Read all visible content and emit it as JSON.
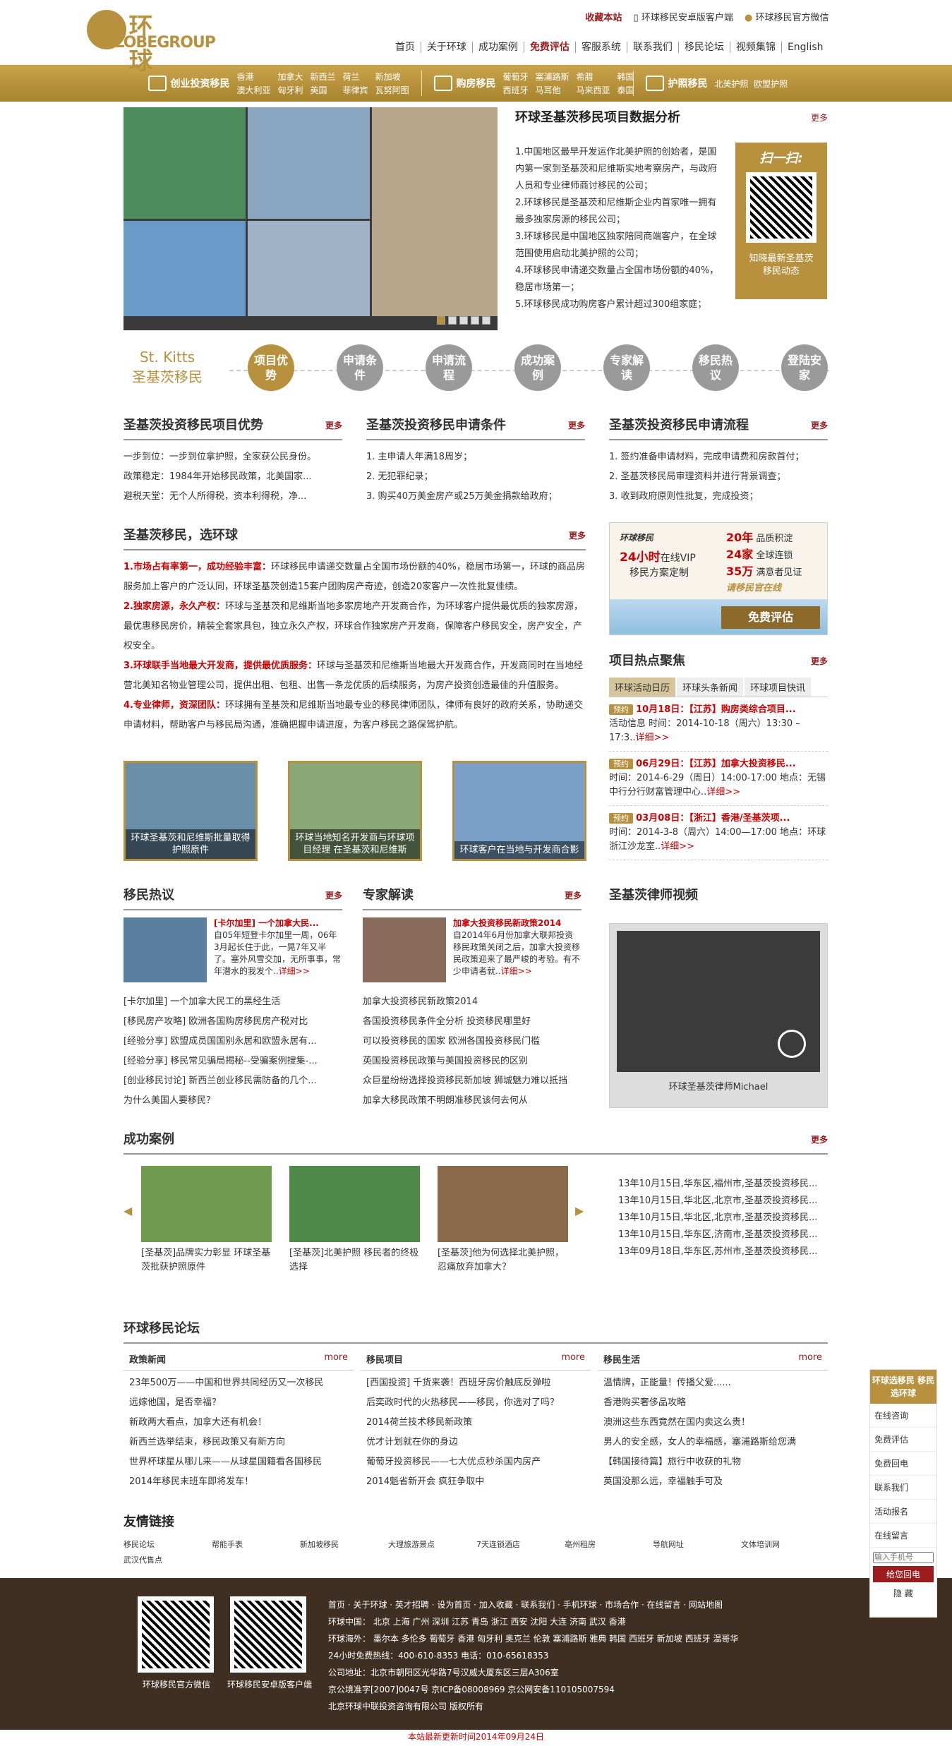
{
  "header": {
    "logo_cn": "环  球",
    "logo_en": "LOBEGROUP",
    "favorite": "收藏本站",
    "app_link": "环球移民安卓版客户端",
    "wechat_link": "环球移民官方微信",
    "nav": [
      "首页",
      "关于环球",
      "成功案例",
      "免费评估",
      "客服系统",
      "联系我们",
      "移民论坛",
      "视频集锦",
      "English"
    ]
  },
  "subbar": {
    "invest": {
      "title": "创业投资移民",
      "links": [
        "香港",
        "澳大利亚",
        "加拿大",
        "匈牙利",
        "新西兰",
        "英国",
        "荷兰",
        "菲律宾",
        "新加坡",
        "瓦努阿图"
      ]
    },
    "house": {
      "title": "购房移民",
      "links": [
        "葡萄牙",
        "塞浦路斯",
        "希腊",
        "韩国",
        "西班牙",
        "马耳他",
        "马来西亚",
        "泰国"
      ]
    },
    "passport": {
      "title": "护照移民",
      "links": [
        "北美护照",
        "欧盟护照"
      ]
    }
  },
  "data_section": {
    "title": "环球圣基茨移民项目数据分析",
    "more": "更多",
    "items": [
      "1.中国地区最早开发运作北美护照的创始者，是国内第一家到圣基茨和尼维斯实地考察房产，与政府人员和专业律师商讨移民的公司；",
      "2.环球移民是圣基茨和尼维斯企业内首家唯一拥有最多独家房源的移民公司；",
      "3.环球移民是中国地区独家陪同商端客户，在全球范围使用启动北美护照的公司；",
      "4.环球移民申请递交数量占全国市场份额的40%，稳居市场第一；",
      "5.环球移民成功购房客户累计超过300组家庭；"
    ],
    "qr_title": "扫一扫:",
    "qr_caption": "知晓最新圣基茨移民动态"
  },
  "tabs": {
    "en": "St. Kitts",
    "cn": "圣基茨移民",
    "items": [
      "项目优势",
      "申请条件",
      "申请流程",
      "成功案例",
      "专家解读",
      "移民热议",
      "登陆安家"
    ]
  },
  "col1": {
    "title": "圣基茨投资移民项目优势",
    "more": "更多",
    "items": [
      "一步到位：一步到位拿护照，全家获公民身份。",
      "政策稳定：1984年开始移民政策，北美国家...",
      "避税天堂：无个人所得税，资本利得税，净..."
    ]
  },
  "col2": {
    "title": "圣基茨投资移民申请条件",
    "more": "更多",
    "items": [
      "1. 主申请人年满18周岁；",
      "2. 无犯罪纪录；",
      "3. 购买40万美金房产或25万美金捐款给政府；"
    ]
  },
  "col3": {
    "title": "圣基茨投资移民申请流程",
    "more": "更多",
    "items": [
      "1. 签约准备申请材料，完成申请费和房款首付；",
      "2. 圣基茨移民局审理资料并进行背景调查；",
      "3. 收到政府原则性批复，完成投资；"
    ]
  },
  "choose": {
    "title": "圣基茨移民，选环球",
    "more": "更多",
    "paras": [
      {
        "h": "1.市场占有率第一，成功经验丰富：",
        "t": "环球移民申请递交数量占全国市场份额的40%，稳居市场第一，环球的商品房服务加上客户的广泛认同，环球圣基茨创造15套户团购房产奇迹，创造20家客户一次性批复佳绩。"
      },
      {
        "h": "2.独家房源，永久产权：",
        "t": "环球与圣基茨和尼维斯当地多家房地产开发商合作，为环球客户提供最优质的独家房源，最优惠移民房价，精装全套家具包，独立永久产权，环球合作独家房产开发商，保障客户移民安全，房产安全，产权安全。"
      },
      {
        "h": "3.环球联手当地最大开发商，提供最优质服务：",
        "t": "环球与圣基茨和尼维斯当地最大开发商合作，开发商同时在当地经营北美知名物业管理公司，提供出租、包租、出售一条龙优质的后续服务，为房产投资创造最佳的升值服务。"
      },
      {
        "h": "4.专业律师，资深团队：",
        "t": "环球拥有圣基茨和尼维斯当地最专业的移民律师团队，律师有良好的政府关系，协助递交申请材料，帮助客户与移民局沟通，准确把握申请进度，为客户移民之路保驾护航。"
      }
    ],
    "images": [
      "环球圣基茨和尼维斯批量取得护照原件",
      "环球当地知名开发商与环球项目经理 在圣基茨和尼维斯",
      "环球客户在当地与开发商合影"
    ]
  },
  "ad": {
    "brand": "环球移民",
    "h24": "24小时",
    "l1": "在线VIP",
    "l2": "移民方案定制",
    "y20": "20年",
    "y20t": "品质积淀",
    "c24": "24家",
    "c24t": "全球连锁",
    "w35": "35万",
    "w35t": "满意者见证",
    "online": "请移民官在线",
    "btn": "免费评估"
  },
  "hot": {
    "title": "项目热点聚焦",
    "more": "更多",
    "tabs": [
      "环球活动日历",
      "环球头条新闻",
      "环球项目快讯"
    ],
    "events": [
      {
        "tag": "预约",
        "date": "10月18日：",
        "title": "【江苏】购房类综合项目...",
        "desc": "活动信息 时间：2014-10-18（周六）13:30 – 17:3..",
        "link": "详细>>"
      },
      {
        "tag": "预约",
        "date": "06月29日：",
        "title": "【江苏】加拿大投资移民...",
        "desc": "时间：2014-6-29（周日）14:00-17:00 地点：无锡中行分行财富管理中心..",
        "link": "详细>>"
      },
      {
        "tag": "预约",
        "date": "03月08日：",
        "title": "【浙江】香港/圣基茨项...",
        "desc": "时间：2014-3-8（周六）14:00—17:00 地点：环球浙江沙龙室..",
        "link": "详细>>"
      }
    ]
  },
  "hotdis": {
    "title": "移民热议",
    "more": "更多",
    "lead_title": "[卡尔加里] 一个加拿大民...",
    "lead_text": "自05年短登卡尔加里一周，06年3月起长住于此，一晃7年又半了。塞外风雪交加，无所事事，常年潜水的我发个..",
    "link": "详细>>",
    "items": [
      "[卡尔加里] 一个加拿大民工的黑经生活",
      "[移民房产攻略] 欧洲各国购房移民房产税对比",
      "[经验分享] 欧盟成员国国别永居和欧盟永居有...",
      "[经验分享] 移民常见骗局揭秘--受骗案例搜集-...",
      "[创业移民讨论] 新西兰创业移民需防备的几个...",
      "为什么美国人要移民？"
    ]
  },
  "expert": {
    "title": "专家解读",
    "more": "更多",
    "lead_title": "加拿大投资移民新政策2014",
    "lead_text": "自2014年6月份加拿大联邦投资移民政策关闭之后，加拿大投资移民政策迎来了最严峻的考验。有不少申请者就..",
    "link": "详细>>",
    "items": [
      "加拿大投资移民新政策2014",
      "各国投资移民条件全分析 投资移民哪里好",
      "可以投资移民的国家 欧洲各国投资移民门槛",
      "英国投资移民政策与美国投资移民的区别",
      "众巨星纷纷选择投资移民新加坡 狮城魅力难以抵挡",
      "加拿大移民政策不明朗准移民该何去何从"
    ]
  },
  "lawyer": {
    "title": "圣基茨律师视频",
    "caption": "环球圣基茨律师Michael"
  },
  "cases": {
    "title": "成功案例",
    "more": "更多",
    "items": [
      "[圣基茨]品牌实力彰显 环球圣基茨批获护照原件",
      "[圣基茨]北美护照 移民者的终极选择",
      "[圣基茨]他为何选择北美护照，忍痛放弃加拿大？"
    ],
    "list": [
      "13年10月15日,华东区,福州市,圣基茨投资移民...",
      "13年10月15日,华北区,北京市,圣基茨投资移民...",
      "13年10月15日,华北区,北京市,圣基茨投资移民...",
      "13年10月15日,华东区,济南市,圣基茨投资移民...",
      "13年09月18日,华东区,苏州市,圣基茨投资移民..."
    ]
  },
  "forum": {
    "title": "环球移民论坛",
    "cols": [
      {
        "title": "政策新闻",
        "more": "more",
        "items": [
          "23年500万——中国和世界共同经历又一次移民",
          "远嫁他国，是否幸福？",
          "新政两大看点，加拿大还有机会！",
          "新西兰选举结束，移民政策又有新方向",
          "世界杯球星从哪儿来——从球星国籍看各国移民",
          "2014年移民末班车即将发车！"
        ]
      },
      {
        "title": "移民项目",
        "more": "more",
        "items": [
          "[西国投资] 千货来袭！西班牙房价触底反弹啦",
          "后奕政时代的火热移民——移民，你选对了吗？",
          "2014荷兰技术移民新政策",
          "优才计划就在你的身边",
          "葡萄牙投资移民——七大优点秒杀国内房产",
          "2014魁省新开会 疯狂争取中"
        ]
      },
      {
        "title": "移民生活",
        "more": "more",
        "items": [
          "温情牌，正能量！传播父爱......",
          "香港购买奢侈品攻略",
          "澳洲这些东西竟然在国内卖这么贵！",
          "男人的安全感，女人的幸福感，塞浦路斯给您满",
          "【韩国接待篇】旅行中收获的礼物",
          "英国没那么远，幸福触手可及"
        ]
      }
    ]
  },
  "friendlinks": {
    "title": "友情链接",
    "items": [
      "移民论坛",
      "帮能手表",
      "新加坡移民",
      "大理旅游景点",
      "7天连锁酒店",
      "亳州租房",
      "导航网址",
      "文体培训网",
      "武汉代售点"
    ]
  },
  "footer": {
    "wechat_caption": "环球移民官方微信",
    "app_caption": "环球移民安卓版客户端",
    "links": "首页 · 关于环球 · 英才招聘 · 设为首页 · 加入收藏 · 联系我们 · 手机环球 · 市场合作 · 在线留言 · 网站地图",
    "china": "环球中国：    北京  上海  广州  深圳  江苏  青岛  浙江  西安  沈阳  大连  济南  武汉  香港",
    "abroad": "环球海外：    墨尔本  多伦多  葡萄牙  香港  匈牙利  奥克兰  伦敦  塞浦路斯  雅典  韩国  西班牙  新加坡  西班牙  温哥华",
    "hotline": "24小时免费热线：400-610-8353    电话：010-65618353",
    "address": "公司地址：北京市朝阳区光华路7号汉威大厦东区三层A306室",
    "icp": "京公境准字[2007]0047号   京ICP备08008969  京公网安备110105007594",
    "copyright": "北京环球中联投资咨询有限公司 版权所有"
  },
  "update": "本站最新更新时间2014年09月24日",
  "float": {
    "title": "环球选移民 移民选环球",
    "items": [
      "在线咨询",
      "免费评估",
      "免费回电",
      "联系我们",
      "活动报名",
      "在线留言"
    ],
    "phone_placeholder": "输入手机号",
    "call_btn": "给您回电",
    "hide": "隐 藏"
  }
}
